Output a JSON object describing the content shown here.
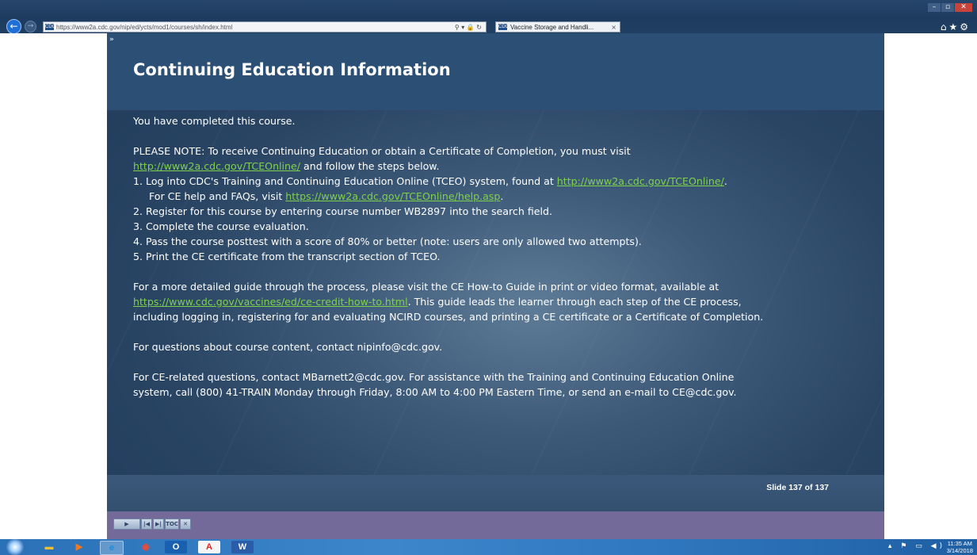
{
  "browser": {
    "url": "https://www2a.cdc.gov/nip/ed/ycts/mod1/courses/sh/index.html",
    "address_icons": "⚲ ▾ 🔒 ↻",
    "tab_title": "Vaccine Storage and Handli...",
    "tab_close": "×",
    "site_icon_text": "CDC"
  },
  "slide": {
    "expand_label": "»",
    "title": "Continuing Education Information",
    "completed": "You have completed this course.",
    "note_lead": "PLEASE NOTE: To receive Continuing Education or obtain a Certificate of Completion, you must visit",
    "note_link": "http://www2a.cdc.gov/TCEOnline/",
    "note_tail": " and follow the steps below.",
    "step1_lead": "1.  Log into CDC's Training and Continuing Education Online (TCEO) system, found at ",
    "step1_link": "http://www2a.cdc.gov/TCEOnline/",
    "step1_tail": ".",
    "step1b_lead": "For CE help and FAQs, visit ",
    "step1b_link": "https://www2a.cdc.gov/TCEOnline/help.asp",
    "step1b_tail": ".",
    "step2": "2.  Register for this course by entering course number WB2897 into the search field.",
    "step3": "3.  Complete the course evaluation.",
    "step4": "4.  Pass the course posttest with a score of 80% or better (note: users are only allowed two attempts).",
    "step5": "5.  Print the CE certificate from the transcript section of TCEO.",
    "guide_lead": "For a more detailed guide through the process, please visit the CE How-to Guide in print or video format, available at",
    "guide_link": "https://www.cdc.gov/vaccines/ed/ce-credit-how-to.html",
    "guide_tail": ". This guide leads the learner through each step of the CE process,",
    "guide_line3": "including logging in, registering for and evaluating NCIRD courses, and printing a CE certificate or a Certificate of Completion.",
    "questions": "For questions about course content, contact nipinfo@cdc.gov.",
    "ce_questions_1": "For CE-related questions, contact MBarnett2@cdc.gov. For assistance with the Training and Continuing Education Online",
    "ce_questions_2": "system, call (800) 41-TRAIN Monday through Friday, 8:00 AM to 4:00 PM Eastern Time, or send an e-mail to CE@cdc.gov.",
    "slide_number": "Slide 137 of 137"
  },
  "player_controls": {
    "play": "▶",
    "first": "|◀",
    "last": "▶|",
    "toc": "TOC",
    "close": "✕"
  },
  "taskbar": {
    "clock_time": "11:35 AM",
    "clock_date": "3/14/2018",
    "tray": "▴ ⚑ ▭ ◀)",
    "icons": {
      "folder": "▬",
      "media": "▶",
      "ie": "e",
      "chrome": "◉",
      "outlook": "O",
      "acrobat": "A",
      "word": "W"
    }
  }
}
